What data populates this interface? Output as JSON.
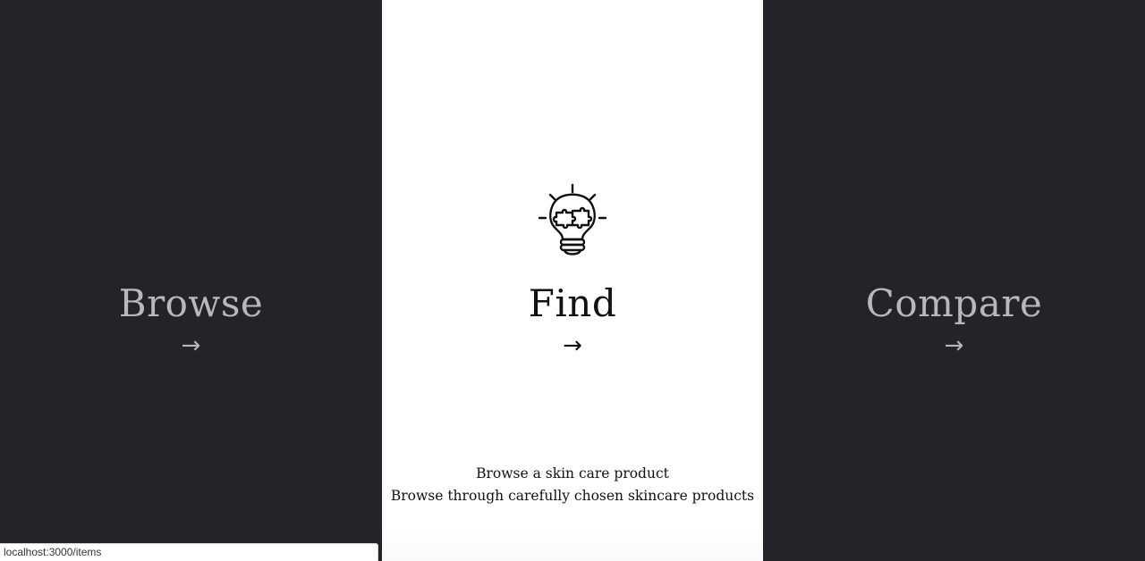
{
  "panels": {
    "browse": {
      "title": "Browse",
      "arrow": "→"
    },
    "find": {
      "title": "Find",
      "arrow": "→",
      "icon": "lightbulb-puzzle-icon",
      "description_heading": "Browse a skin care product",
      "description_text": "Browse through carefully chosen skincare products"
    },
    "compare": {
      "title": "Compare",
      "arrow": "→"
    }
  },
  "status_bar": {
    "url": "localhost:3000/items"
  },
  "colors": {
    "dark_panel": "#222428",
    "light_panel": "#ffffff",
    "dark_text": "#b8b8b8",
    "light_text": "#111111"
  }
}
